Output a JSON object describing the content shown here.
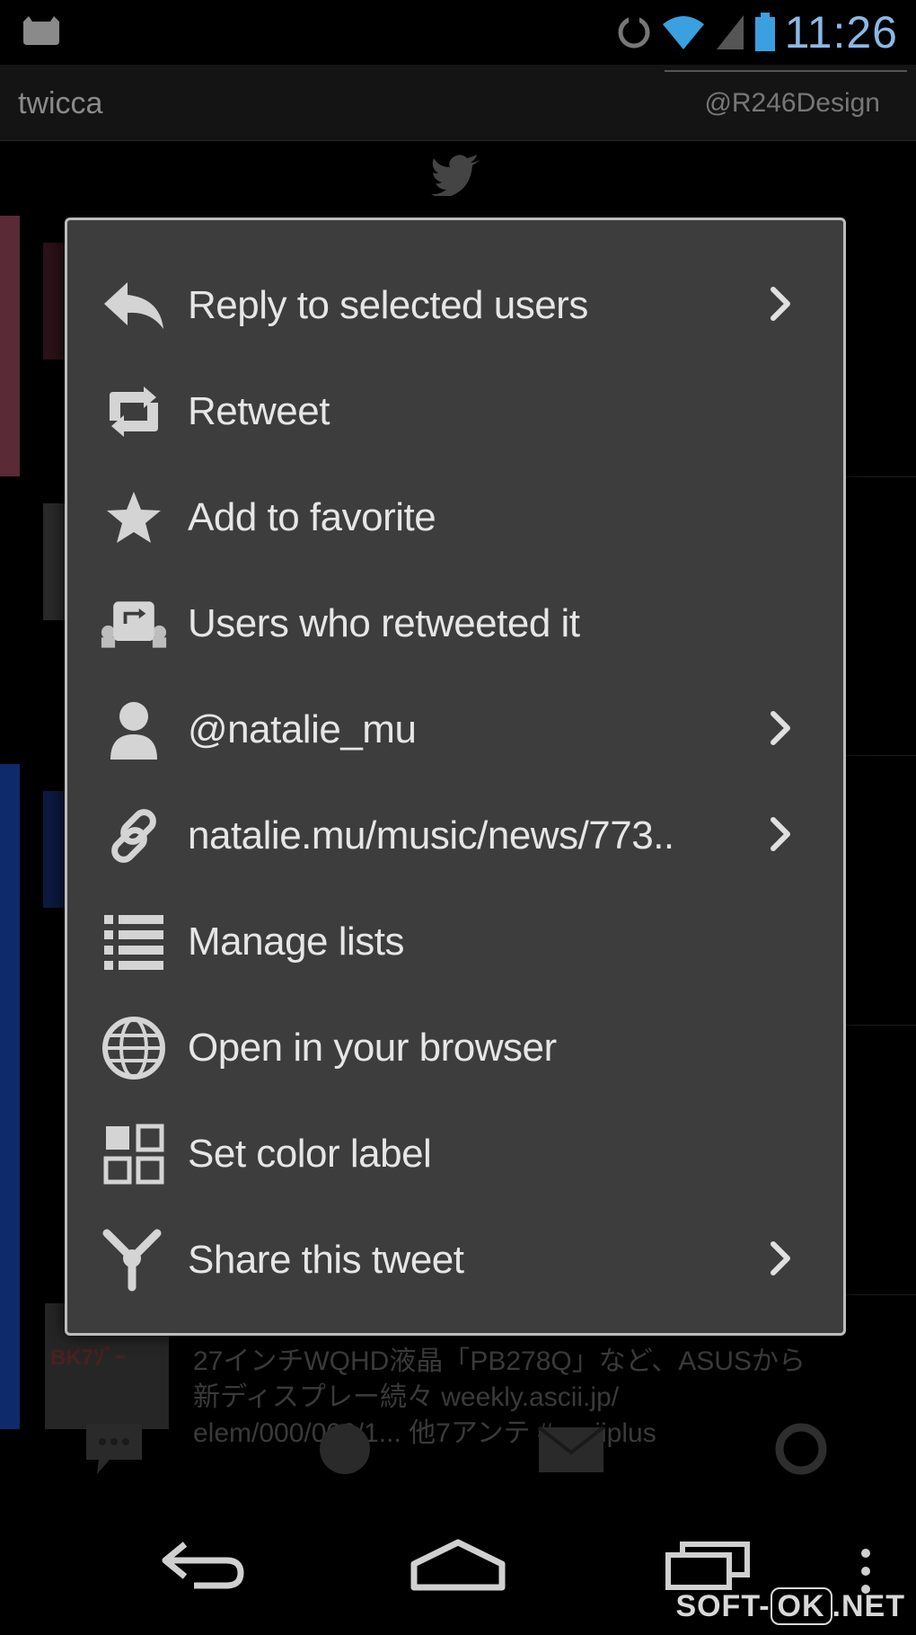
{
  "status_bar": {
    "time": "11:26"
  },
  "action_bar": {
    "app_title": "twicca",
    "account": "@R246Design"
  },
  "menu": {
    "items": [
      {
        "label": "Reply to selected users",
        "icon": "reply-icon",
        "has_submenu": true
      },
      {
        "label": "Retweet",
        "icon": "retweet-icon",
        "has_submenu": false
      },
      {
        "label": "Add to favorite",
        "icon": "star-icon",
        "has_submenu": false
      },
      {
        "label": "Users who retweeted it",
        "icon": "users-retweeted-icon",
        "has_submenu": false
      },
      {
        "label": "@natalie_mu",
        "icon": "user-icon",
        "has_submenu": true
      },
      {
        "label": "natalie.mu/music/news/773..",
        "icon": "link-icon",
        "has_submenu": true
      },
      {
        "label": "Manage lists",
        "icon": "list-icon",
        "has_submenu": false
      },
      {
        "label": "Open in your browser",
        "icon": "globe-icon",
        "has_submenu": false
      },
      {
        "label": "Set color label",
        "icon": "color-label-icon",
        "has_submenu": false
      },
      {
        "label": "Share this tweet",
        "icon": "share-icon",
        "has_submenu": true
      }
    ]
  },
  "background_tweet": {
    "thumb_text": "BK7ｿﾞｰ",
    "line1": "27インチWQHD液晶「PB278Q」など、ASUSから",
    "line2": "新ディスプレー続々 weekly.ascii.jp/",
    "line3": "elem/000/000/1... 他7アンテ #asciiplus"
  },
  "watermark": {
    "left": "SOFT-",
    "ok": "OK",
    "right": ".NET"
  }
}
